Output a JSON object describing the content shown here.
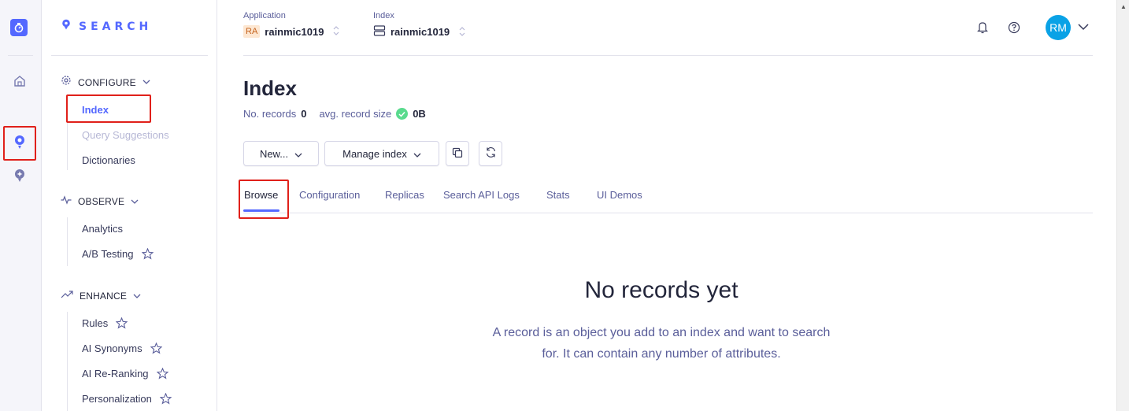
{
  "rail": {
    "items": [
      "logo-icon",
      "home-icon",
      "search-icon",
      "recommend-icon"
    ]
  },
  "sidebar": {
    "brand": "SEARCH",
    "sections": [
      {
        "label": "CONFIGURE",
        "icon": "gear-icon",
        "items": [
          {
            "label": "Index",
            "state": "active"
          },
          {
            "label": "Query Suggestions",
            "state": "disabled"
          },
          {
            "label": "Dictionaries",
            "state": "normal"
          }
        ]
      },
      {
        "label": "OBSERVE",
        "icon": "pulse-icon",
        "items": [
          {
            "label": "Analytics",
            "state": "normal"
          },
          {
            "label": "A/B Testing",
            "state": "normal",
            "star": true
          }
        ]
      },
      {
        "label": "ENHANCE",
        "icon": "trend-icon",
        "items": [
          {
            "label": "Rules",
            "state": "normal",
            "star": true
          },
          {
            "label": "AI Synonyms",
            "state": "normal",
            "star": true
          },
          {
            "label": "AI Re-Ranking",
            "state": "normal",
            "star": true
          },
          {
            "label": "Personalization",
            "state": "normal",
            "star": true
          }
        ]
      }
    ]
  },
  "header": {
    "application_label": "Application",
    "application_badge": "RA",
    "application_value": "rainmic1019",
    "index_label": "Index",
    "index_value": "rainmic1019",
    "avatar_initials": "RM"
  },
  "page": {
    "title": "Index",
    "records_label": "No. records",
    "records_value": "0",
    "size_label": "avg. record size",
    "size_value": "0B"
  },
  "toolbar": {
    "new_label": "New...",
    "manage_label": "Manage index"
  },
  "tabs": [
    "Browse",
    "Configuration",
    "Replicas",
    "Search API Logs",
    "Stats",
    "UI Demos"
  ],
  "empty_state": {
    "title": "No records yet",
    "text": "A record is an object you add to an index and want to search for. It can contain any number of attributes."
  },
  "colors": {
    "accent": "#5468ff",
    "highlight": "#e0201a",
    "success": "#5adb8e",
    "avatar": "#0aa2e6"
  }
}
